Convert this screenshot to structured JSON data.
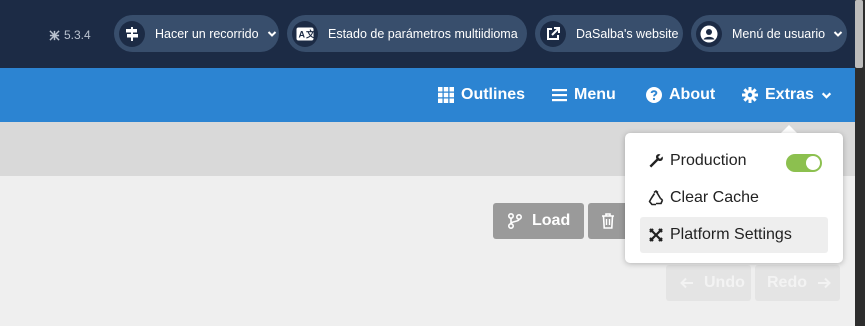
{
  "header": {
    "version": "5.3.4",
    "tour_label": "Hacer un recorrido",
    "multilang_label": "Estado de parámetros multiidioma",
    "website_label": "DaSalba's website",
    "user_menu_label": "Menú de usuario"
  },
  "toolbar": {
    "outlines": "Outlines",
    "menu": "Menu",
    "about": "About",
    "extras": "Extras"
  },
  "actions": {
    "load": "Load",
    "undo": "Undo",
    "redo": "Redo"
  },
  "extras_menu": {
    "production": "Production",
    "production_enabled": true,
    "clear_cache": "Clear Cache",
    "platform_settings": "Platform Settings"
  },
  "colors": {
    "header_bg": "#1c2b45",
    "toolbar_bg": "#2c84d2",
    "toggle_on": "#8cc04f"
  }
}
